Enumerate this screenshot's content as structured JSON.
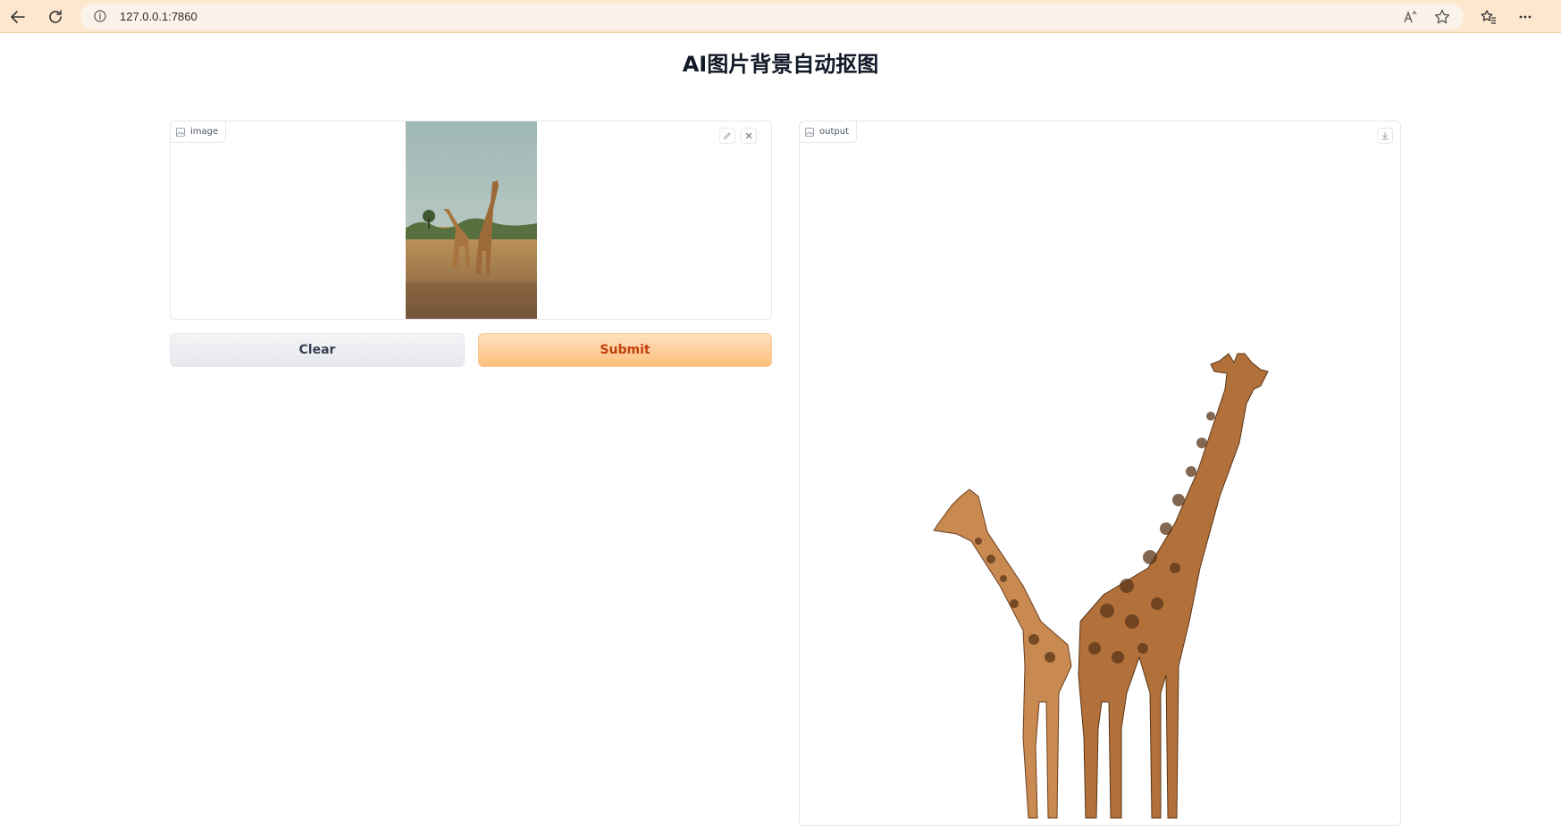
{
  "browser": {
    "url": "127.0.0.1:7860",
    "icons": [
      "back-icon",
      "refresh-icon",
      "info-icon",
      "read-aloud-icon",
      "star-icon",
      "favorites-icon",
      "more-icon"
    ]
  },
  "page": {
    "title": "AI图片背景自动抠图"
  },
  "input": {
    "label": "image",
    "icons": [
      "image-icon",
      "edit-icon",
      "close-icon"
    ]
  },
  "actions": {
    "clear_label": "Clear",
    "submit_label": "Submit"
  },
  "output": {
    "label": "output",
    "icons": [
      "image-icon",
      "download-icon"
    ]
  },
  "colors": {
    "chrome_bg": "#fde7cf",
    "submit_bg": "#fdbf7d",
    "submit_text": "#c2410c",
    "clear_bg": "#e7e8ec"
  }
}
